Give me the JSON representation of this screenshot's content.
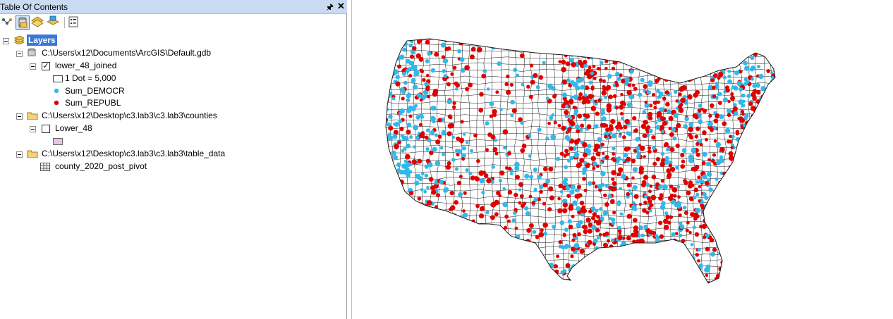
{
  "panel": {
    "title": "Table Of Contents",
    "pin_glyph": "⍐",
    "close_glyph": "✕"
  },
  "toolbar": {
    "buttons": [
      {
        "icon": "list-by-drawing-order-icon"
      },
      {
        "icon": "list-by-source-icon",
        "active": true
      },
      {
        "icon": "list-by-visibility-icon"
      },
      {
        "icon": "list-by-selection-icon"
      },
      {
        "icon": "options-icon"
      }
    ]
  },
  "toc": {
    "layers_label": "Layers",
    "gdb_path": "C:\\Users\\x12\\Documents\\ArcGIS\\Default.gdb",
    "joined_layer": {
      "name": "lower_48_joined",
      "checked": true,
      "legend": {
        "dot_value": "1 Dot = 5,000",
        "items": [
          {
            "label": "Sum_DEMOCR",
            "color": "#33b8e8"
          },
          {
            "label": "Sum_REPUBL",
            "color": "#e00000"
          }
        ]
      }
    },
    "counties_path": "C:\\Users\\x12\\Desktop\\c3.lab3\\c3.lab3\\counties",
    "counties_layer": {
      "name": "Lower_48",
      "checked": false,
      "swatch_color": "#e6c4e6"
    },
    "table_path": "C:\\Users\\x12\\Desktop\\c3.lab3\\c3.lab3\\table_data",
    "table_name": "county_2020_post_pivot"
  },
  "map": {
    "description_colors": {
      "outline": "#1a1a1a",
      "democrat": "#33b8e8",
      "republican": "#e00000"
    }
  }
}
